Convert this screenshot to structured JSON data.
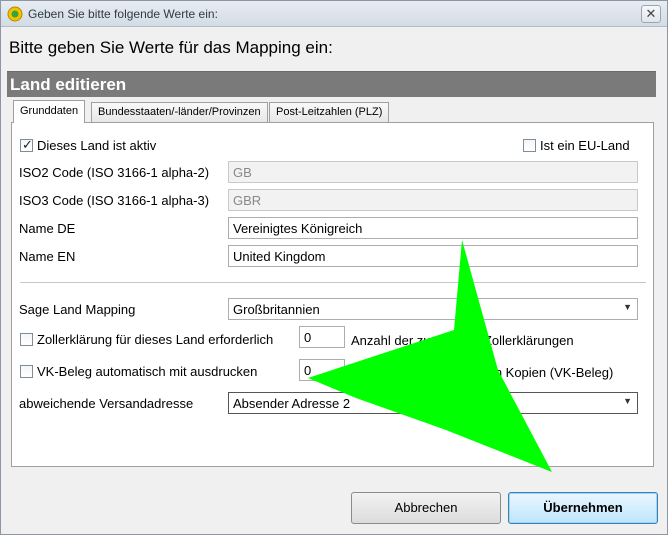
{
  "window": {
    "title": "Geben Sie bitte folgende Werte ein:",
    "close_glyph": "✕"
  },
  "heading": "Bitte geben Sie Werte für das Mapping ein:",
  "section_title": "Land editieren",
  "tabs": [
    {
      "label": "Grunddaten",
      "active": true
    },
    {
      "label": "Bundesstaaten/-länder/Provinzen",
      "active": false
    },
    {
      "label": "Post-Leitzahlen (PLZ)",
      "active": false
    }
  ],
  "form": {
    "active_checkbox": {
      "label": "Dieses Land ist aktiv",
      "checked": true
    },
    "eu_checkbox": {
      "label": "Ist ein EU-Land",
      "checked": false
    },
    "iso2": {
      "label": "ISO2 Code (ISO 3166-1 alpha-2)",
      "value": "GB"
    },
    "iso3": {
      "label": "ISO3 Code (ISO 3166-1 alpha-3)",
      "value": "GBR"
    },
    "name_de": {
      "label": "Name DE",
      "value": "Vereinigtes Königreich"
    },
    "name_en": {
      "label": "Name EN",
      "value": "United Kingdom"
    },
    "sage_mapping": {
      "label": "Sage Land Mapping",
      "value": "Großbritannien"
    },
    "customs": {
      "label": "Zollerklärung für dieses Land erforderlich",
      "checked": false,
      "value": "0",
      "count_label": "Anzahl der zu drucken Zollerklärungen"
    },
    "vk_beleg": {
      "label": "VK-Beleg automatisch mit ausdrucken",
      "checked": false,
      "value": "0",
      "count_label": "Anzahl der zu druckenden Kopien (VK-Beleg)"
    },
    "shipping_address": {
      "label": "abweichende Versandadresse",
      "value": "Absender Adresse 2"
    }
  },
  "buttons": {
    "cancel": "Abbrechen",
    "apply": "Übernehmen"
  },
  "colors": {
    "arrow": "#00ff00",
    "section_bar": "#7a7a7a",
    "primary_button": "#bee6fd"
  },
  "icons": {
    "app": "app-icon",
    "close": "close-icon",
    "dropdown": "chevron-down-icon",
    "check": "checkmark-icon"
  }
}
